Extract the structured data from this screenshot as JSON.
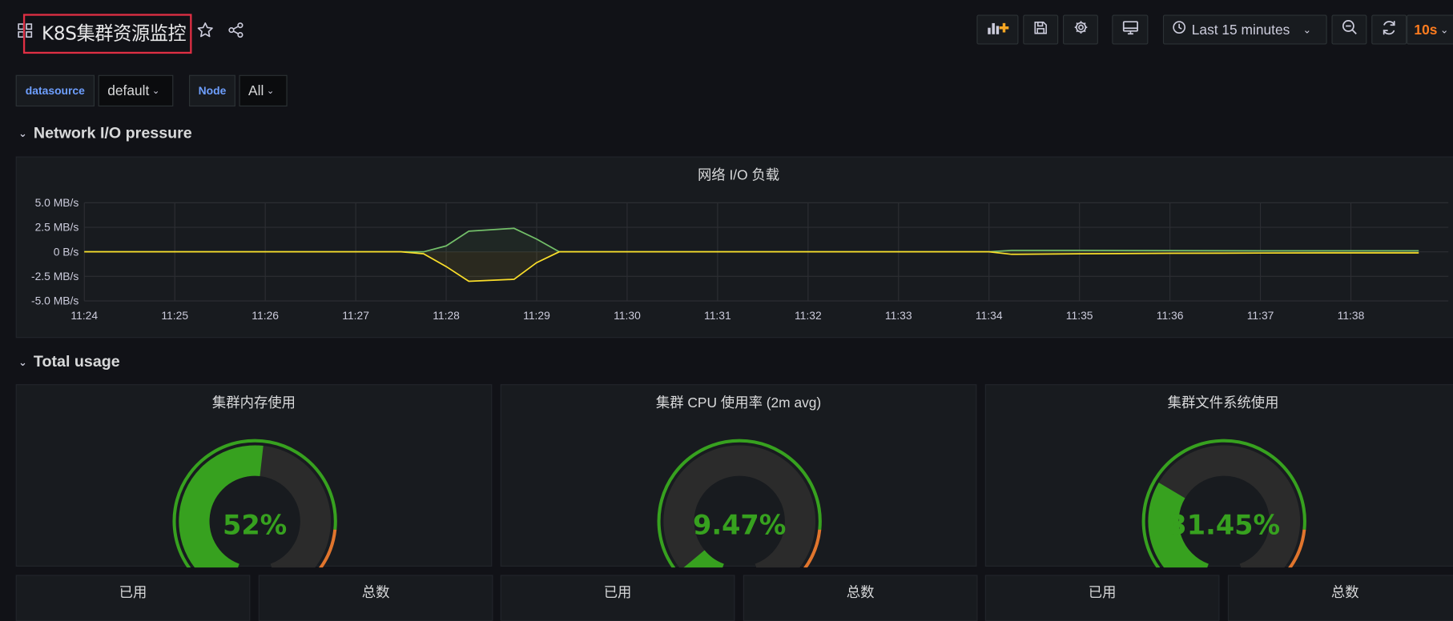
{
  "header": {
    "title": "K8S集群资源监控",
    "time_range": "Last 15 minutes",
    "refresh_interval": "10s",
    "icons": [
      "grid-icon",
      "star-icon",
      "share-icon",
      "add-panel-icon",
      "save-icon",
      "gear-icon",
      "tv-icon",
      "clock-icon",
      "zoom-out-icon",
      "refresh-icon"
    ]
  },
  "variables": [
    {
      "label": "datasource",
      "value": "default"
    },
    {
      "label": "Node",
      "value": "All"
    }
  ],
  "rows": [
    {
      "title": "Network I/O pressure"
    },
    {
      "title": "Total usage"
    }
  ],
  "network_panel": {
    "title": "网络 I/O 负载",
    "chart_data": {
      "type": "line",
      "x": [
        "11:24",
        "11:24:30",
        "11:25",
        "11:25:30",
        "11:26",
        "11:26:30",
        "11:27",
        "11:27:30",
        "11:27:45",
        "11:28",
        "11:28:15",
        "11:28:45",
        "11:29",
        "11:29:15",
        "11:30",
        "11:31",
        "11:32",
        "11:33",
        "11:34",
        "11:34:15",
        "11:35",
        "11:36",
        "11:37",
        "11:38",
        "11:38:45"
      ],
      "xticks": [
        "11:24",
        "11:25",
        "11:26",
        "11:27",
        "11:28",
        "11:29",
        "11:30",
        "11:31",
        "11:32",
        "11:33",
        "11:34",
        "11:35",
        "11:36",
        "11:37",
        "11:38"
      ],
      "yticks": [
        "5.0 MB/s",
        "2.5 MB/s",
        "0 B/s",
        "-2.5 MB/s",
        "-5.0 MB/s"
      ],
      "ylim": [
        -5,
        5
      ],
      "unit": "MB/s",
      "series": [
        {
          "color": "#73bf69",
          "values": [
            0,
            0,
            0,
            0,
            0,
            0,
            0,
            0,
            0,
            0.6,
            2.1,
            2.4,
            1.3,
            0,
            0,
            0,
            0,
            0,
            0,
            0.15,
            0.15,
            0.12,
            0.1,
            0.1,
            0.1
          ]
        },
        {
          "color": "#fade2a",
          "values": [
            0,
            0,
            0,
            0,
            0,
            0,
            0,
            0,
            -0.2,
            -1.5,
            -3.0,
            -2.8,
            -1.1,
            0,
            0,
            0,
            0,
            0,
            0,
            -0.25,
            -0.2,
            -0.15,
            -0.12,
            -0.1,
            -0.1
          ]
        }
      ],
      "grid": true
    }
  },
  "gauges": [
    {
      "title": "集群内存使用",
      "value": 52,
      "display": "52%"
    },
    {
      "title": "集群 CPU 使用率 (2m avg)",
      "value": 9.47,
      "display": "9.47%"
    },
    {
      "title": "集群文件系统使用",
      "value": 31.45,
      "display": "31.45%"
    }
  ],
  "gauge_thresholds": {
    "green": "#37a11f",
    "orange": "#e0752d",
    "red": "#e02f44",
    "orange_from": 80,
    "red_from": 90
  },
  "stats": [
    {
      "title": "已用"
    },
    {
      "title": "总数"
    },
    {
      "title": "已用"
    },
    {
      "title": "总数"
    },
    {
      "title": "已用"
    },
    {
      "title": "总数"
    }
  ]
}
